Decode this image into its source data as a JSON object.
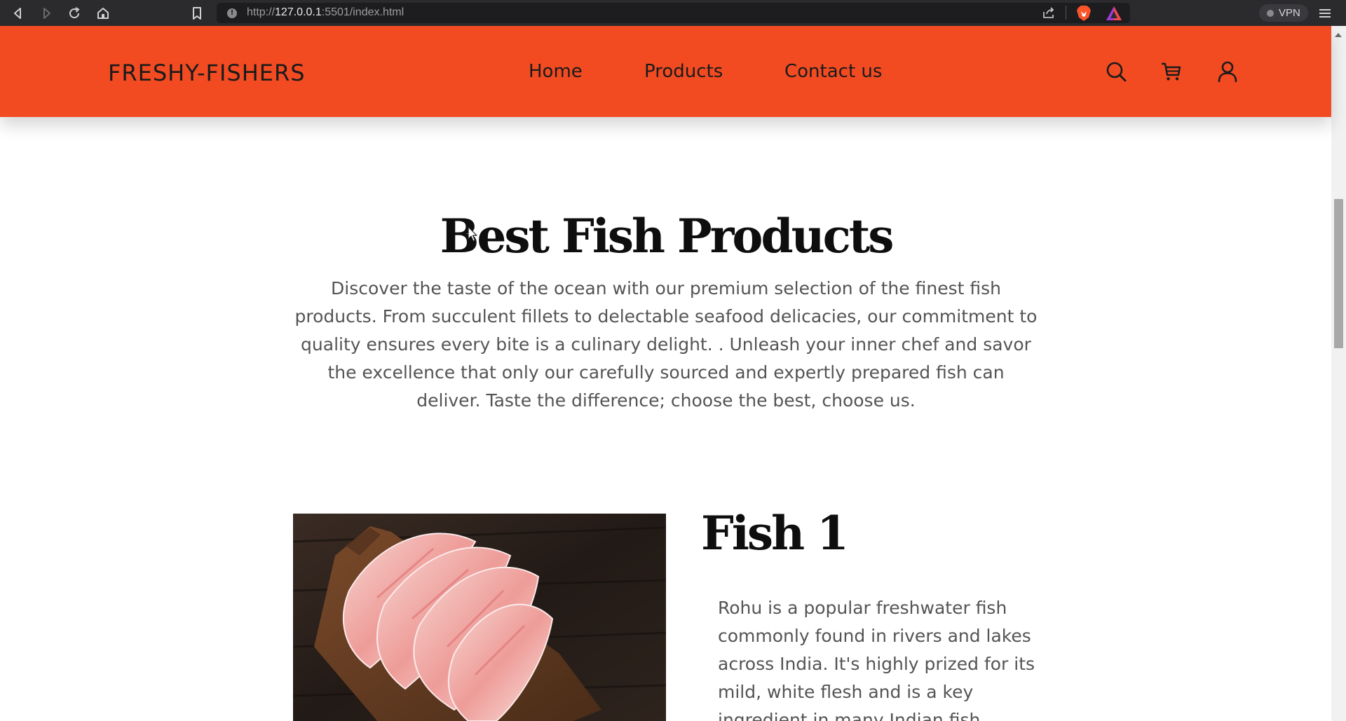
{
  "browser": {
    "url_scheme": "http://",
    "url_host": "127.0.0.1",
    "url_path": ":5501/index.html",
    "vpn_label": "VPN"
  },
  "header": {
    "logo": "FRESHY-FISHERS",
    "nav": [
      {
        "label": "Home"
      },
      {
        "label": "Products"
      },
      {
        "label": "Contact us"
      }
    ],
    "icons": [
      "search-icon",
      "cart-icon",
      "user-icon"
    ],
    "background_color": "#f24b22"
  },
  "main": {
    "title": "Best Fish Products",
    "description": "Discover the taste of the ocean with our premium selection of the finest fish products. From succulent fillets to delectable seafood delicacies, our commitment to quality ensures every bite is a culinary delight. . Unleash your inner chef and savor the excellence that only our carefully sourced and expertly prepared fish can deliver. Taste the difference; choose the best, choose us."
  },
  "product": {
    "title": "Fish 1",
    "description": "Rohu is a popular freshwater fish commonly found in rivers and lakes across India. It's highly prized for its mild, white flesh and is a key ingredient in many Indian fish"
  }
}
